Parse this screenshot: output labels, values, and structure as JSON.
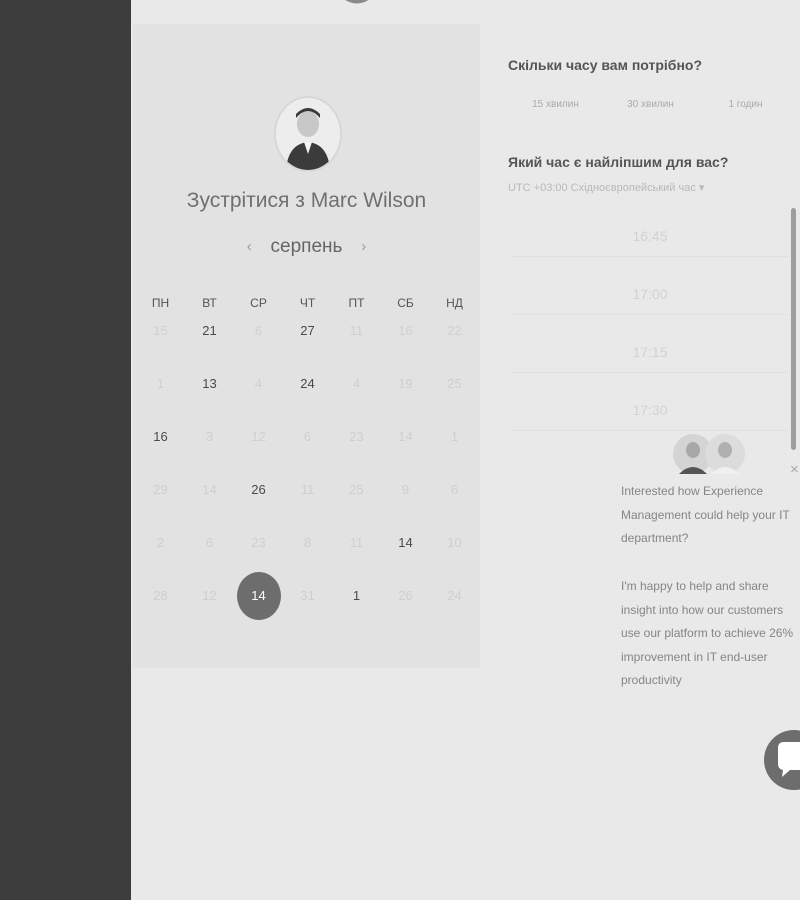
{
  "booking": {
    "meet_title": "Зустрітися з Marc Wilson",
    "month": "серпень",
    "prev_arrow": "‹",
    "next_arrow": "›",
    "weekdays": [
      "ПН",
      "ВТ",
      "СР",
      "ЧТ",
      "ПТ",
      "СБ",
      "НД"
    ],
    "weeks": [
      [
        {
          "d": "15",
          "a": false
        },
        {
          "d": "21",
          "a": true
        },
        {
          "d": "6",
          "a": false
        },
        {
          "d": "27",
          "a": true
        },
        {
          "d": "11",
          "a": false
        },
        {
          "d": "16",
          "a": false
        },
        {
          "d": "22",
          "a": false
        }
      ],
      [
        {
          "d": "1",
          "a": false
        },
        {
          "d": "13",
          "a": true
        },
        {
          "d": "4",
          "a": false
        },
        {
          "d": "24",
          "a": true
        },
        {
          "d": "4",
          "a": false
        },
        {
          "d": "19",
          "a": false
        },
        {
          "d": "25",
          "a": false
        }
      ],
      [
        {
          "d": "16",
          "a": true
        },
        {
          "d": "3",
          "a": false
        },
        {
          "d": "12",
          "a": false
        },
        {
          "d": "6",
          "a": false
        },
        {
          "d": "23",
          "a": false
        },
        {
          "d": "14",
          "a": false
        },
        {
          "d": "1",
          "a": false
        }
      ],
      [
        {
          "d": "29",
          "a": false
        },
        {
          "d": "14",
          "a": false
        },
        {
          "d": "26",
          "a": true
        },
        {
          "d": "11",
          "a": false
        },
        {
          "d": "25",
          "a": false
        },
        {
          "d": "9",
          "a": false
        },
        {
          "d": "6",
          "a": false
        }
      ],
      [
        {
          "d": "2",
          "a": false
        },
        {
          "d": "6",
          "a": false
        },
        {
          "d": "23",
          "a": false
        },
        {
          "d": "8",
          "a": false
        },
        {
          "d": "11",
          "a": false
        },
        {
          "d": "14",
          "a": true
        },
        {
          "d": "10",
          "a": false
        }
      ],
      [
        {
          "d": "28",
          "a": false
        },
        {
          "d": "12",
          "a": false
        },
        {
          "d": "14",
          "a": true,
          "selected": true
        },
        {
          "d": "31",
          "a": false
        },
        {
          "d": "1",
          "a": true
        },
        {
          "d": "26",
          "a": false
        },
        {
          "d": "24",
          "a": false
        }
      ]
    ]
  },
  "right": {
    "duration_question": "Скільки часу вам потрібно?",
    "durations": [
      "15 хвилин",
      "30 хвилин",
      "1 годин"
    ],
    "time_question": "Який час є найліпшим для вас?",
    "timezone": "UTC +03:00 Східноєвропейський час",
    "timezone_caret": "▾",
    "slots": [
      "16:45",
      "17:00",
      "17:15",
      "17:30"
    ]
  },
  "chat": {
    "close": "×",
    "message_1": "Interested how Experience Management could help your IT department?",
    "message_2": "I'm happy to help and share insight into how our customers use our platform to achieve 26% improvement in IT end-user productivity"
  }
}
